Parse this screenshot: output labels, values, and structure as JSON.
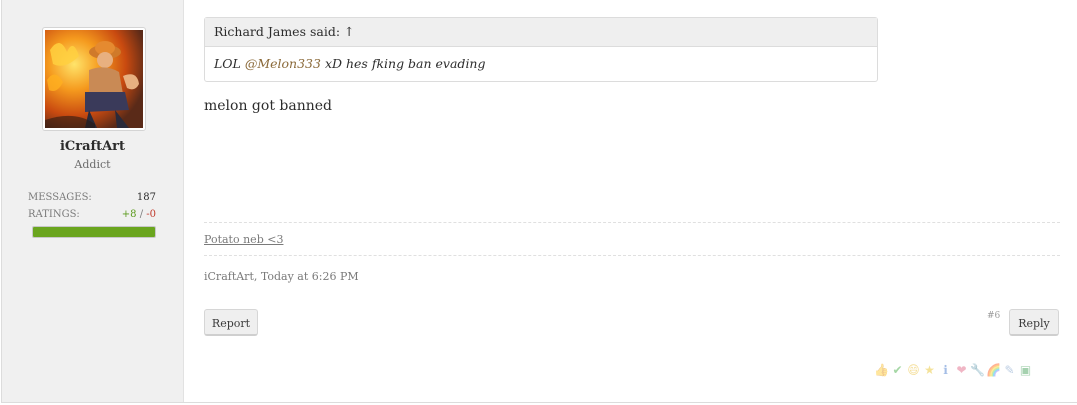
{
  "user": {
    "name": "iCraftArt",
    "title": "Addict",
    "messages_label": "MESSAGES:",
    "messages_value": "187",
    "ratings_label": "RATINGS:",
    "ratings_pos": "+8",
    "ratings_sep": " / ",
    "ratings_neg": "-0",
    "rating_fill_fraction": 1.0
  },
  "quote": {
    "header": "Richard James said: ↑",
    "text_prefix": "LOL ",
    "mention": "@Melon333",
    "text_suffix": " xD hes fking ban evading"
  },
  "message": "melon got banned",
  "signature": "Potato neb <3",
  "meta": "iCraftArt, Today at 6:26 PM",
  "actions": {
    "report_label": "Report",
    "reply_label": "Reply",
    "post_number": "#6"
  },
  "rating_icons": [
    {
      "name": "like-icon",
      "glyph": "👍",
      "color": "#d8a060"
    },
    {
      "name": "agree-icon",
      "glyph": "✔",
      "color": "#3aa83a"
    },
    {
      "name": "funny-icon",
      "glyph": "😄",
      "color": "#e8b820"
    },
    {
      "name": "winner-icon",
      "glyph": "★",
      "color": "#e8c020"
    },
    {
      "name": "informative-icon",
      "glyph": "ℹ",
      "color": "#3a70c8"
    },
    {
      "name": "love-icon",
      "glyph": "❤",
      "color": "#e06080"
    },
    {
      "name": "useful-icon",
      "glyph": "🔧",
      "color": "#c89050"
    },
    {
      "name": "rainbow-icon",
      "glyph": "🌈",
      "color": "#d07030"
    },
    {
      "name": "creative-icon",
      "glyph": "✎",
      "color": "#6a90c0"
    },
    {
      "name": "dumb-icon",
      "glyph": "▣",
      "color": "#3a9a50"
    }
  ]
}
